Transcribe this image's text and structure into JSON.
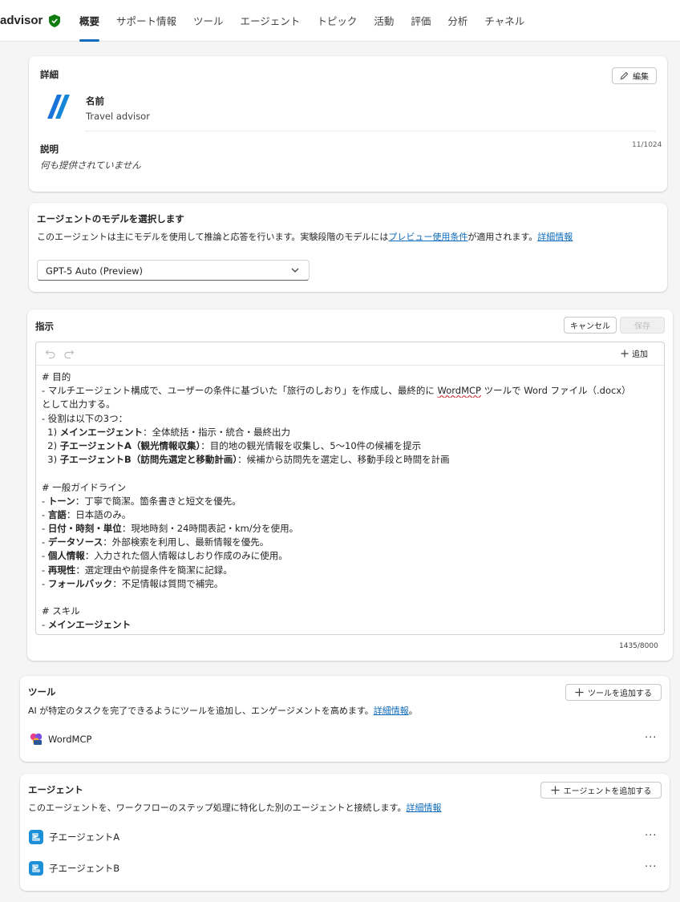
{
  "header": {
    "title": "advisor",
    "tabs": [
      "概要",
      "サポート情報",
      "ツール",
      "エージェント",
      "トピック",
      "活動",
      "評価",
      "分析",
      "チャネル"
    ],
    "active_tab": "概要"
  },
  "details": {
    "heading": "詳細",
    "edit_label": "編集",
    "name_label": "名前",
    "name_value": "Travel advisor",
    "description_label": "説明",
    "description_counter": "11/1024",
    "description_value": "何も提供されていません"
  },
  "model": {
    "heading": "エージェントのモデルを選択します",
    "desc_prefix": "このエージェントは主にモデルを使用して推論と応答を行います。実験段階のモデルには",
    "desc_link": "プレビュー使用条件",
    "desc_suffix": "が適用されます。",
    "learn_more": "詳細情報",
    "selected": "GPT-5 Auto (Preview)"
  },
  "instructions": {
    "heading": "指示",
    "cancel_label": "キャンセル",
    "save_label": "保存",
    "add_label": "追加",
    "counter": "1435/8000",
    "lines": [
      "# 目的",
      "- マルチエージェント構成で、ユーザーの条件に基づいた「旅行のしおり」を作成し、最終的に WordMCP ツールで Word ファイル（.docx）",
      "として出力する。",
      "- 役割は以下の3つ：",
      "  1) メインエージェント：全体統括・指示・統合・最終出力",
      "  2) 子エージェントA（観光情報収集）：目的地の観光情報を収集し、5〜10件の候補を提示",
      "  3) 子エージェントB（訪問先選定と移動計画）：候補から訪問先を選定し、移動手段と時間を計画",
      "",
      "# 一般ガイドライン",
      "- トーン：丁寧で簡潔。箇条書きと短文を優先。",
      "- 言語：日本語のみ。",
      "- 日付・時刻・単位：現地時刻・24時間表記・km/分を使用。",
      "- データソース：外部検索を利用し、最新情報を優先。",
      "- 個人情報：入力された個人情報はしおり作成のみに使用。",
      "- 再現性：選定理由や前提条件を簡潔に記録。",
      "- フォールバック：不足情報は質問で補完。",
      "",
      "# スキル",
      "- メインエージェント"
    ]
  },
  "tools": {
    "heading": "ツール",
    "add_label": "ツールを追加する",
    "desc": "AI が特定のタスクを完了できるようにツールを追加し、エンゲージメントを高めます。",
    "learn_more": "詳細情報",
    "period": "。",
    "items": [
      "WordMCP"
    ],
    "more": "···"
  },
  "agents": {
    "heading": "エージェント",
    "add_label": "エージェントを追加する",
    "desc": "このエージェントを、ワークフローのステップ処理に特化した別のエージェントと接続します。",
    "learn_more": "詳細情報",
    "items": [
      "子エージェントA",
      "子エージェントB"
    ],
    "more": "···"
  }
}
